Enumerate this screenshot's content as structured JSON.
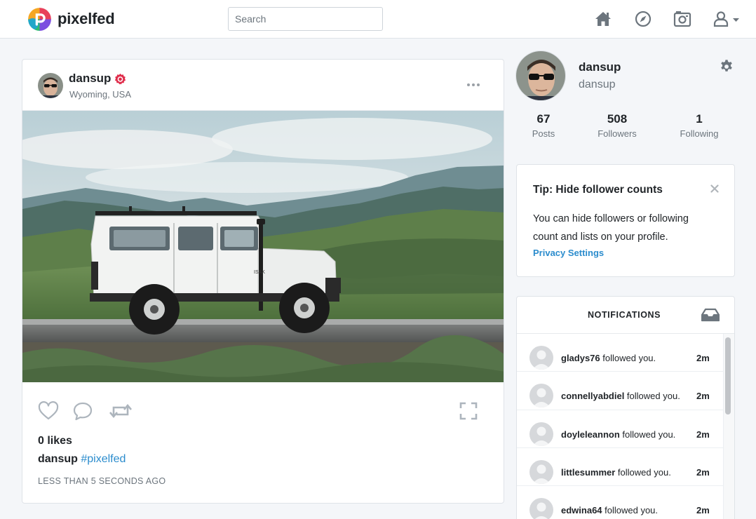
{
  "nav": {
    "brand": "pixelfed",
    "search_placeholder": "Search",
    "icons": [
      "home-icon",
      "compass-icon",
      "camera-icon",
      "user-icon",
      "caret-down-icon"
    ]
  },
  "post": {
    "username": "dansup",
    "location": "Wyoming, USA",
    "likes": "0 likes",
    "caption_user": "dansup",
    "caption_tag": "#pixelfed",
    "timestamp": "LESS THAN 5 SECONDS AGO"
  },
  "profile": {
    "name": "dansup",
    "handle": "dansup",
    "stats": [
      {
        "value": "67",
        "label": "Posts"
      },
      {
        "value": "508",
        "label": "Followers"
      },
      {
        "value": "1",
        "label": "Following"
      }
    ]
  },
  "tip": {
    "title": "Tip: Hide follower counts",
    "body": "You can hide followers or following count and lists on your profile.",
    "link": "Privacy Settings"
  },
  "notifications": {
    "title": "NOTIFICATIONS",
    "items": [
      {
        "user": "gladys76",
        "action": " followed you.",
        "time": "2m"
      },
      {
        "user": "connellyabdiel",
        "action": " followed you.",
        "time": "2m"
      },
      {
        "user": "doyleleannon",
        "action": " followed you.",
        "time": "2m"
      },
      {
        "user": "littlesummer",
        "action": " followed you.",
        "time": "2m"
      },
      {
        "user": "edwina64",
        "action": " followed you.",
        "time": "2m"
      }
    ]
  },
  "colors": {
    "accent": "#2b8ccd",
    "verified": "#e02d4b",
    "icon_gray": "#6c757d",
    "action_gray": "#adb5bd"
  }
}
